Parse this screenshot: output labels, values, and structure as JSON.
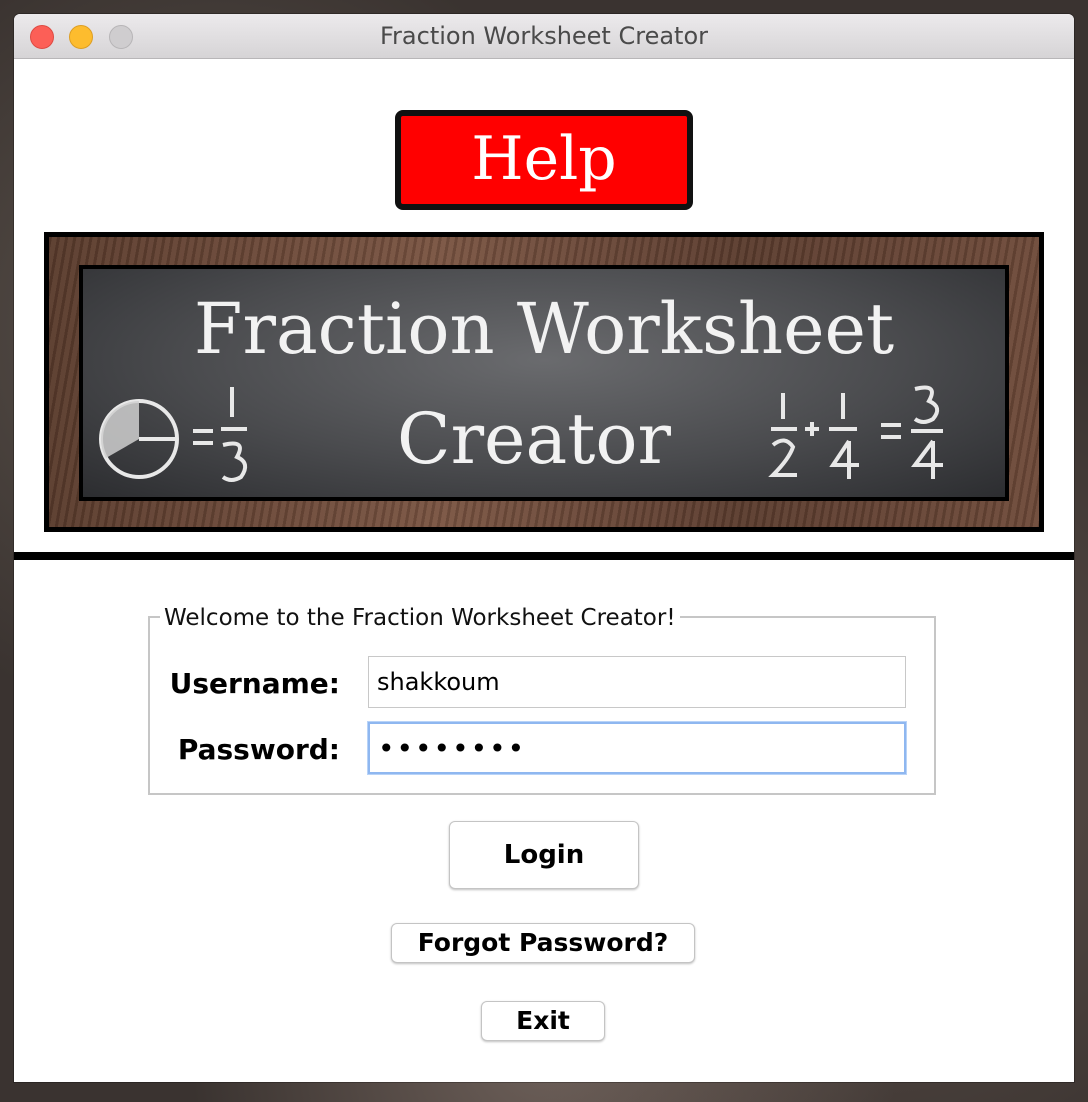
{
  "window": {
    "title": "Fraction Worksheet Creator"
  },
  "header": {
    "help_label": "Help",
    "banner_line1": "Fraction Worksheet",
    "banner_line2": "Creator"
  },
  "login": {
    "group_title": "Welcome to the Fraction Worksheet Creator!",
    "username_label": "Username:",
    "username_value": "shakkoum",
    "password_label": "Password:",
    "password_value": "••••••••"
  },
  "buttons": {
    "login_label": "Login",
    "forgot_label": "Forgot Password?",
    "exit_label": "Exit"
  },
  "colors": {
    "help_button": "#ff0000",
    "focus_ring": "#8fb7f0"
  }
}
